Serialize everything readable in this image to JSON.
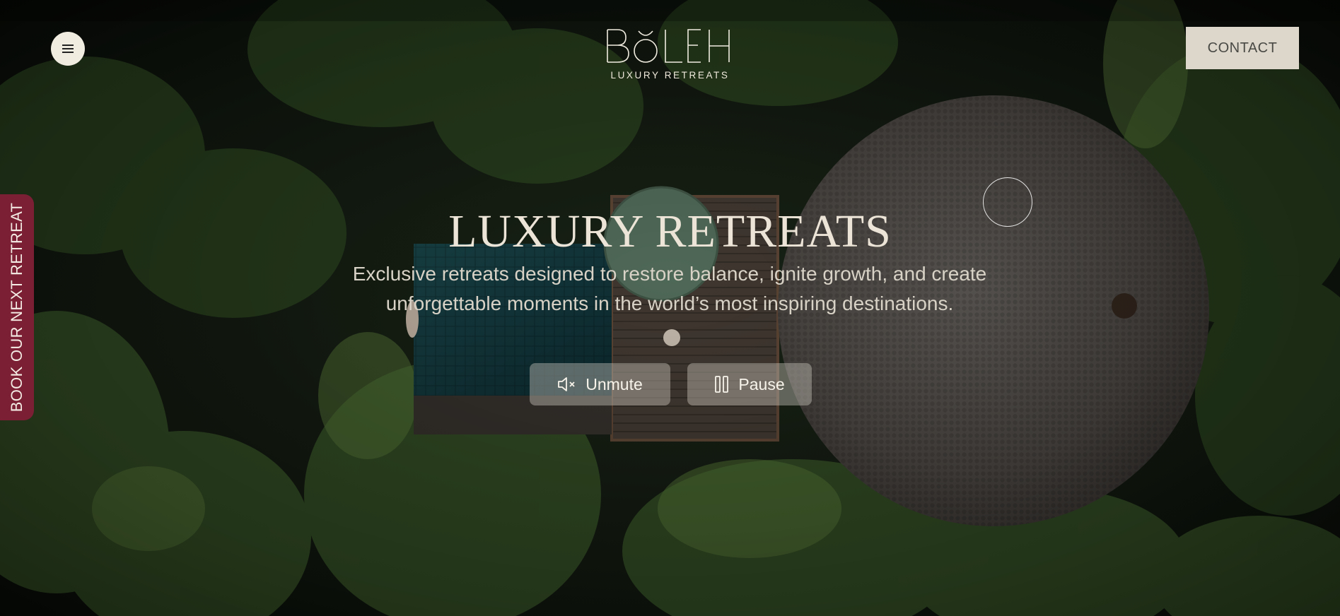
{
  "header": {
    "logo_text": "BŎLEH",
    "logo_tagline": "LUXURY RETREATS",
    "contact_label": "CONTACT"
  },
  "menu": {
    "icon": "hamburger-icon"
  },
  "side_tab": {
    "label": "BOOK OUR NEXT RETREAT",
    "color": "#7a1f34"
  },
  "hero": {
    "title": "LUXURY RETREATS",
    "subtitle": "Exclusive retreats designed to restore balance, ignite growth, and create unforgettable moments in the world’s most inspiring destinations."
  },
  "controls": {
    "unmute_label": "Unmute",
    "unmute_icon": "speaker-muted-icon",
    "pause_label": "Pause",
    "pause_icon": "pause-icon"
  },
  "colors": {
    "cream": "#f1ece0",
    "contact_bg": "#dcd6cb",
    "accent": "#7a1f34"
  }
}
